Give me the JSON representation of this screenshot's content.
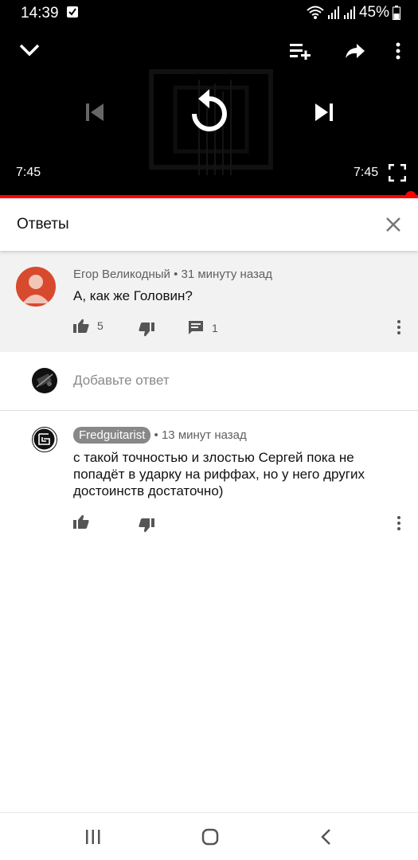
{
  "status_bar": {
    "time": "14:39",
    "battery": "45%",
    "icons": [
      "notification-icon",
      "wifi-icon",
      "signal-icon",
      "signal-icon",
      "battery-icon"
    ]
  },
  "player": {
    "current_time": "7:45",
    "duration": "7:45",
    "progress": 1.0,
    "icons": [
      "collapse-icon",
      "add-to-queue-icon",
      "share-icon",
      "more-icon",
      "previous-icon",
      "replay-icon",
      "next-icon",
      "fullscreen-icon"
    ],
    "accent_color": "#ff0000"
  },
  "replies_panel": {
    "title": "Ответы",
    "close_icon": "close-icon"
  },
  "parent_comment": {
    "author": "Егор Великодный",
    "time": "31 минуту назад",
    "text": "А, как же Головин?",
    "likes": "5",
    "replies": "1",
    "avatar_color": "#d84a2e"
  },
  "add_reply": {
    "placeholder": "Добавьте ответ"
  },
  "reply": {
    "author": "Fredguitarist",
    "time": "13 минут назад",
    "text": "с такой точностью и злостью Сергей пока не попадёт в ударку на риффах, но у него других достоинств достаточно)"
  },
  "nav_bar": {
    "icons": [
      "recents-icon",
      "home-icon",
      "back-icon"
    ]
  }
}
